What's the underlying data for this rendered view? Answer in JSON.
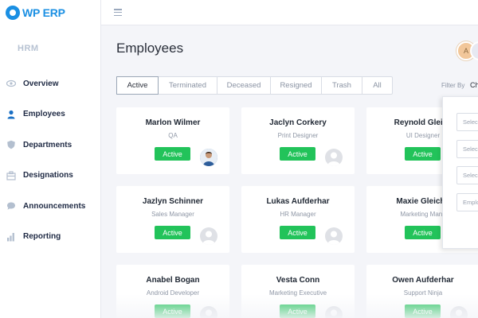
{
  "app": {
    "logo_text": "WP ERP"
  },
  "sidebar": {
    "module_title": "HRM",
    "items": [
      {
        "label": "Overview",
        "icon": "eye-icon"
      },
      {
        "label": "Employees",
        "icon": "user-icon"
      },
      {
        "label": "Departments",
        "icon": "shield-icon"
      },
      {
        "label": "Designations",
        "icon": "building-icon"
      },
      {
        "label": "Announcements",
        "icon": "chat-icon"
      },
      {
        "label": "Reporting",
        "icon": "chart-icon"
      }
    ]
  },
  "header": {
    "page_title": "Employees",
    "user_initial": "A"
  },
  "tabs": [
    "Active",
    "Terminated",
    "Deceased",
    "Resigned",
    "Trash",
    "All"
  ],
  "filter": {
    "label": "Filter By",
    "value": "Ch",
    "selects": [
      "Selec",
      "Selec",
      "Selec",
      "Emplo"
    ]
  },
  "employees": [
    {
      "name": "Marlon Wilmer",
      "role": "QA",
      "status": "Active"
    },
    {
      "name": "Jaclyn Corkery",
      "role": "Print Designer",
      "status": "Active"
    },
    {
      "name": "Reynold Gleich",
      "role": "UI Designer",
      "status": "Active"
    },
    {
      "name": "Jazlyn Schinner",
      "role": "Sales Manager",
      "status": "Active"
    },
    {
      "name": "Lukas Aufderhar",
      "role": "HR Manager",
      "status": "Active"
    },
    {
      "name": "Maxie Gleichn",
      "role": "Marketing Mana",
      "status": "Active"
    },
    {
      "name": "Anabel Bogan",
      "role": "Android Developer",
      "status": "Active"
    },
    {
      "name": "Vesta Conn",
      "role": "Marketing Executive",
      "status": "Active"
    },
    {
      "name": "Owen Aufderhar",
      "role": "Support Ninja",
      "status": "Active"
    }
  ],
  "colors": {
    "brand": "#1a8fe3",
    "status_active": "#22c35a",
    "sidebar_icon": "#1a8fe3"
  }
}
